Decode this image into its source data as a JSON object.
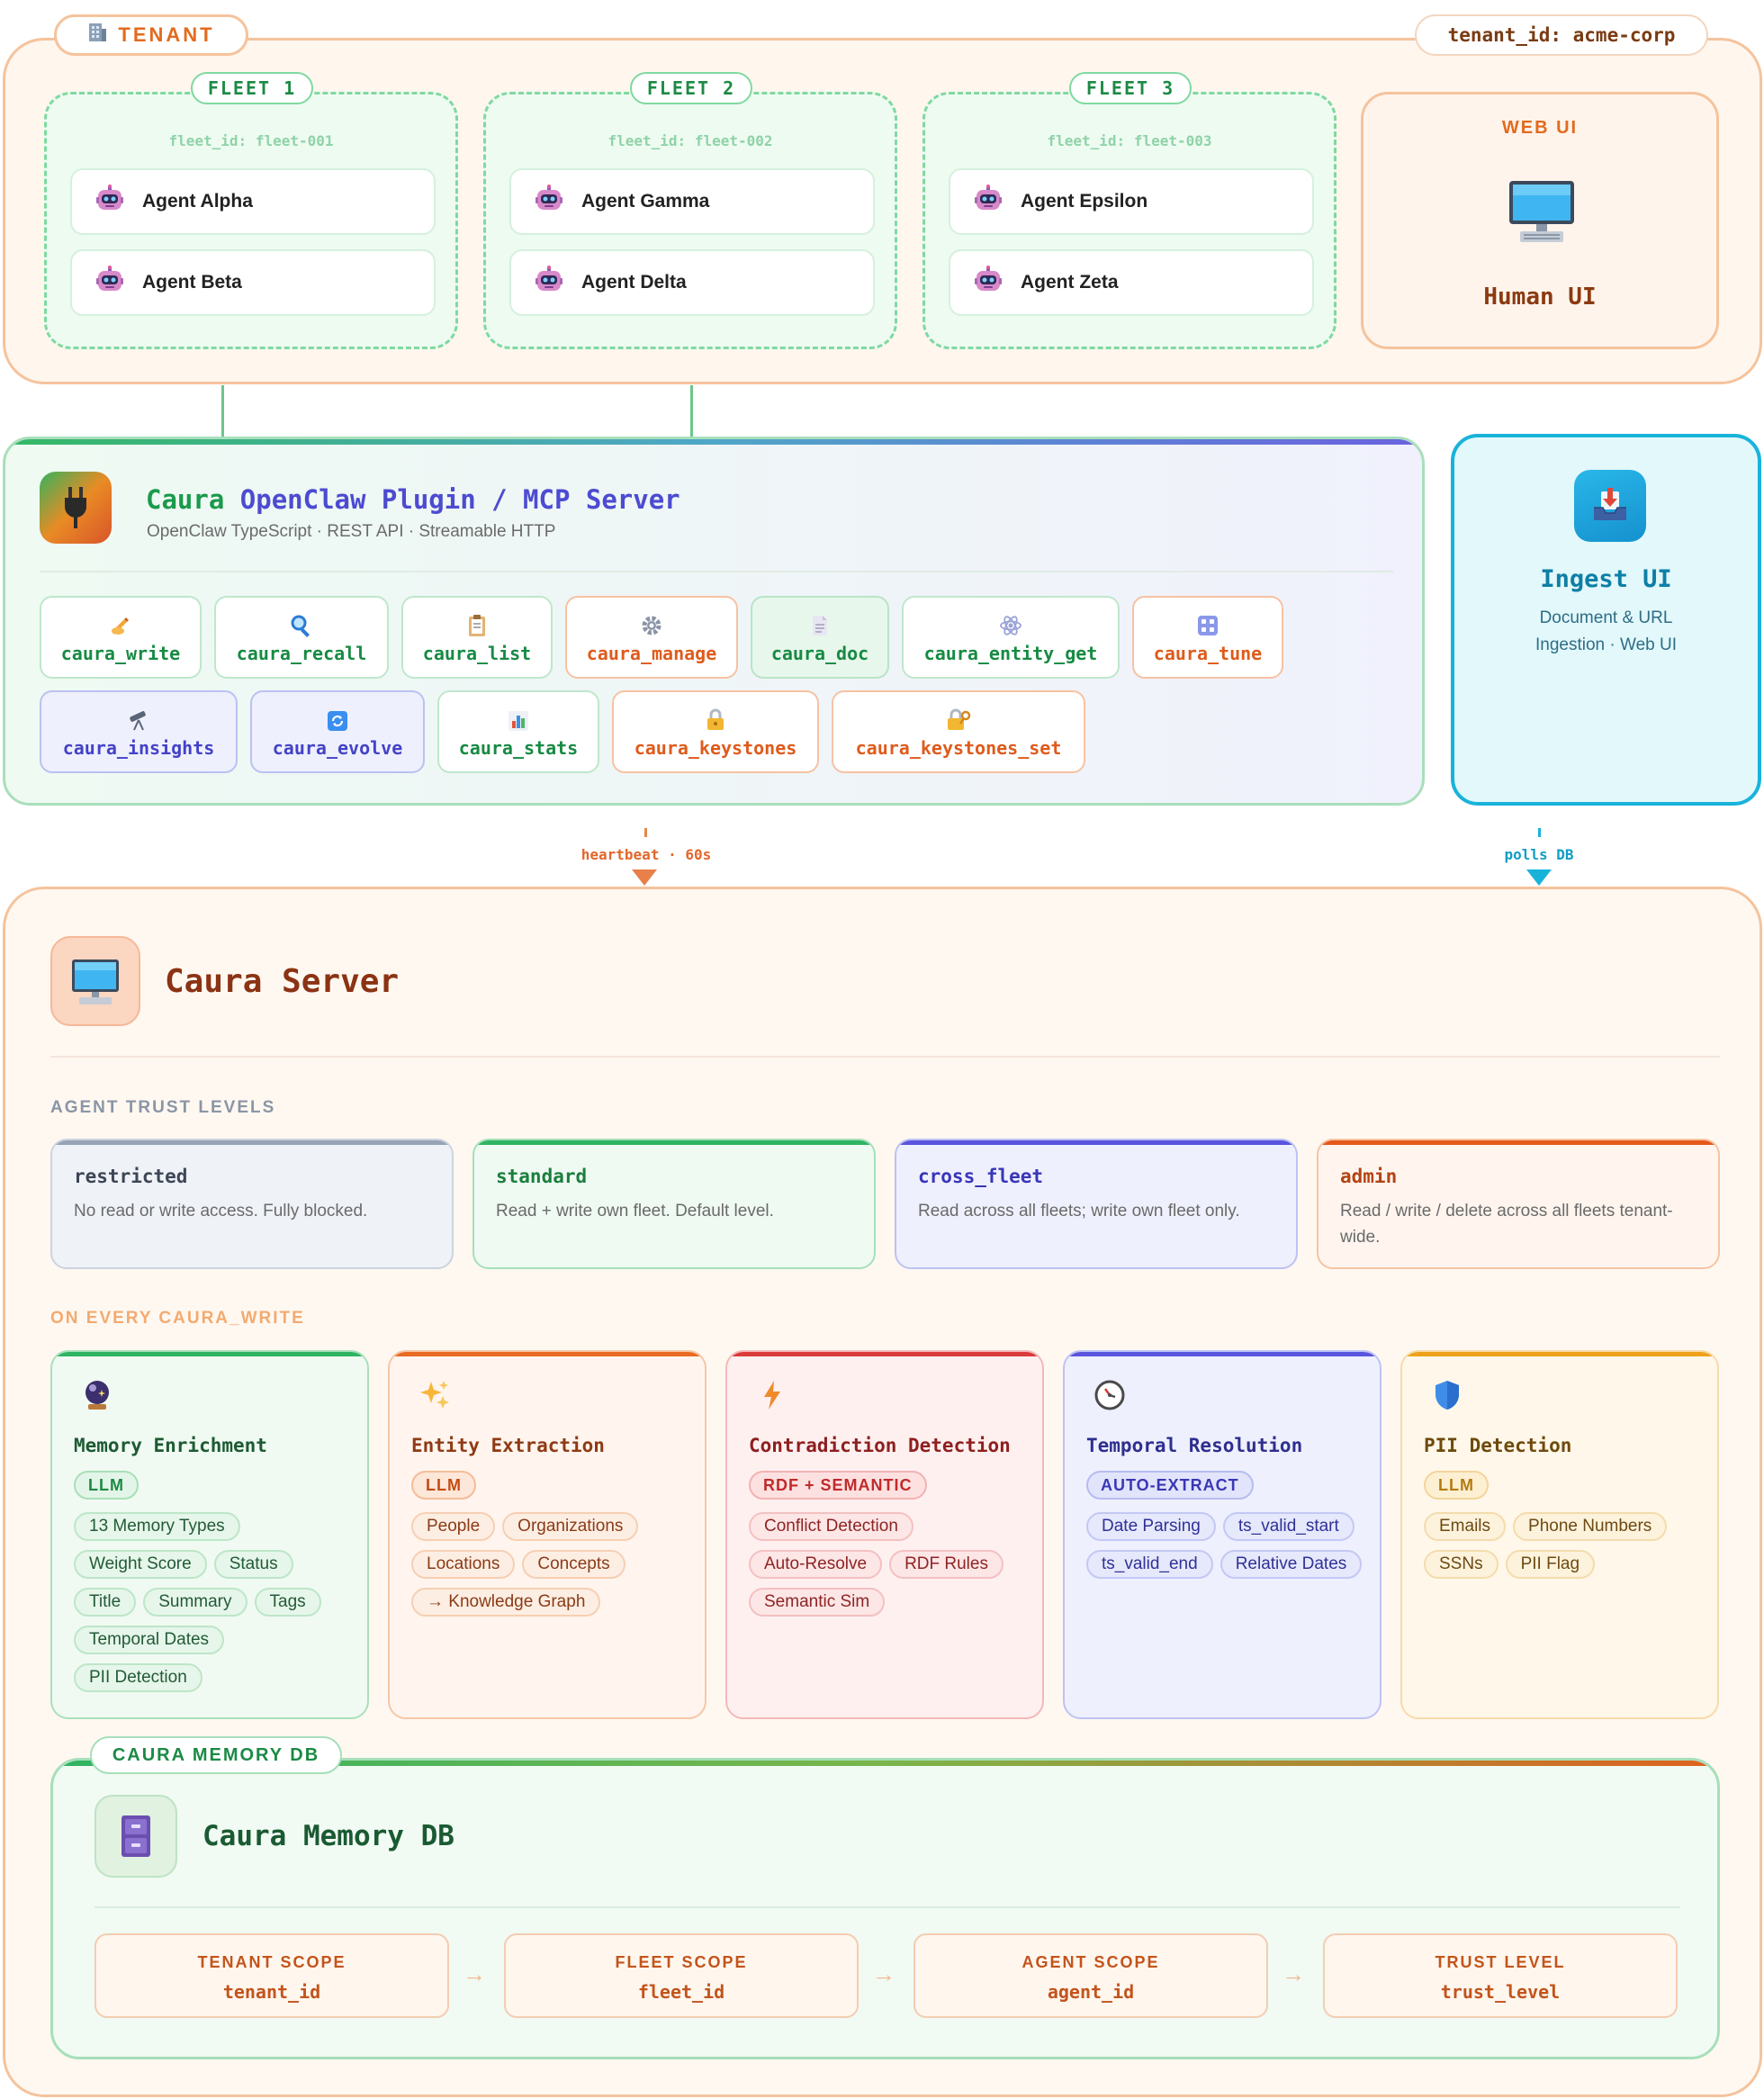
{
  "tenant": {
    "label": "TENANT",
    "label_icon": "building-icon",
    "tenant_id": "tenant_id: acme-corp",
    "fleets": [
      {
        "label": "FLEET 1",
        "fleet_id": "fleet_id: fleet-001",
        "agents": [
          "Agent Alpha",
          "Agent Beta"
        ]
      },
      {
        "label": "FLEET 2",
        "fleet_id": "fleet_id: fleet-002",
        "agents": [
          "Agent Gamma",
          "Agent Delta"
        ]
      },
      {
        "label": "FLEET 3",
        "fleet_id": "fleet_id: fleet-003",
        "agents": [
          "Agent Epsilon",
          "Agent Zeta"
        ]
      }
    ],
    "agent_icon": "robot-icon",
    "web_ui": {
      "title": "WEB UI",
      "icon": "computer-icon",
      "name": "Human UI"
    }
  },
  "plugin": {
    "title_a": "Caura",
    "title_b": "OpenClaw Plugin / MCP Server",
    "subtitle": "OpenClaw TypeScript · REST API · Streamable HTTP",
    "icon": "plug-icon",
    "tools": [
      {
        "name": "caura_write",
        "icon": "writing-hand-icon"
      },
      {
        "name": "caura_recall",
        "icon": "magnifier-icon"
      },
      {
        "name": "caura_list",
        "icon": "clipboard-icon"
      },
      {
        "name": "caura_manage",
        "icon": "gear-icon"
      },
      {
        "name": "caura_doc",
        "icon": "document-icon"
      },
      {
        "name": "caura_entity_get",
        "icon": "atom-icon"
      },
      {
        "name": "caura_tune",
        "icon": "grid-icon"
      },
      {
        "name": "caura_insights",
        "icon": "telescope-icon"
      },
      {
        "name": "caura_evolve",
        "icon": "refresh-icon"
      },
      {
        "name": "caura_stats",
        "icon": "bar-chart-icon"
      },
      {
        "name": "caura_keystones",
        "icon": "lock-icon"
      },
      {
        "name": "caura_keystones_set",
        "icon": "lock-key-icon"
      }
    ]
  },
  "ingest": {
    "title": "Ingest UI",
    "line1": "Document & URL",
    "line2": "Ingestion · Web UI",
    "icon": "inbox-tray-icon"
  },
  "arrows": {
    "heartbeat": "heartbeat · 60s",
    "polls": "polls DB"
  },
  "server": {
    "title": "Caura Server",
    "icon": "desktop-computer-icon",
    "trust_section": "AGENT TRUST LEVELS",
    "trust_levels": [
      {
        "name": "restricted",
        "desc": "No read or write access. Fully blocked."
      },
      {
        "name": "standard",
        "desc": "Read + write own fleet. Default level."
      },
      {
        "name": "cross_fleet",
        "desc": "Read across all fleets; write own fleet only."
      },
      {
        "name": "admin",
        "desc": "Read / write / delete across all fleets tenant-wide."
      }
    ],
    "write_section": "ON EVERY CAURA_WRITE",
    "processes": [
      {
        "name": "Memory Enrichment",
        "icon": "crystal-ball-icon",
        "badge": "LLM",
        "tags": [
          "13 Memory Types",
          "Weight Score",
          "Status",
          "Title",
          "Summary",
          "Tags",
          "Temporal Dates",
          "PII Detection"
        ]
      },
      {
        "name": "Entity Extraction",
        "icon": "sparkles-icon",
        "badge": "LLM",
        "tags": [
          "People",
          "Organizations",
          "Locations",
          "Concepts",
          "→ Knowledge Graph"
        ]
      },
      {
        "name": "Contradiction Detection",
        "icon": "lightning-icon",
        "badge": "RDF + SEMANTIC",
        "tags": [
          "Conflict Detection",
          "Auto-Resolve",
          "RDF Rules",
          "Semantic Sim"
        ]
      },
      {
        "name": "Temporal Resolution",
        "icon": "clock-icon",
        "badge": "AUTO-EXTRACT",
        "tags": [
          "Date Parsing",
          "ts_valid_start",
          "ts_valid_end",
          "Relative Dates"
        ]
      },
      {
        "name": "PII Detection",
        "icon": "shield-icon",
        "badge": "LLM",
        "tags": [
          "Emails",
          "Phone Numbers",
          "SSNs",
          "PII Flag"
        ]
      }
    ]
  },
  "db": {
    "label": "CAURA MEMORY DB",
    "title": "Caura Memory DB",
    "icon": "file-cabinet-icon",
    "scopes": [
      {
        "heading": "TENANT SCOPE",
        "field": "tenant_id"
      },
      {
        "heading": "FLEET SCOPE",
        "field": "fleet_id"
      },
      {
        "heading": "AGENT SCOPE",
        "field": "agent_id"
      },
      {
        "heading": "TRUST LEVEL",
        "field": "trust_level"
      }
    ],
    "arrow": "→"
  },
  "colors": {
    "tenant_border": "#f5c39c",
    "fleet_green": "#1d8a45",
    "plugin_purple": "#4c4bd1",
    "ingest_cyan": "#19b3da",
    "server_brown": "#8b3314"
  }
}
